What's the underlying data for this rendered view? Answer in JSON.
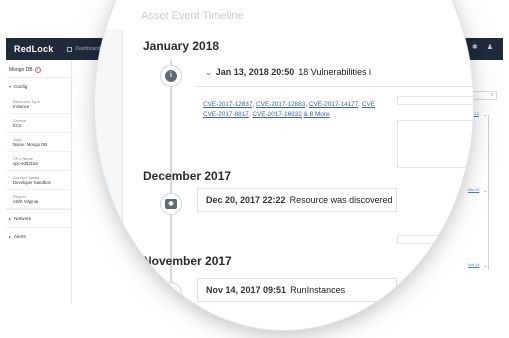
{
  "app": {
    "brand": "RedLock",
    "nav_dashboard": "Dashboard"
  },
  "sidebar": {
    "resource_title": "Mongo DB",
    "config_section": "Config",
    "fields": [
      {
        "label": "Resource Type",
        "value": "Instance"
      },
      {
        "label": "Service",
        "value": "EC2"
      },
      {
        "label": "Tags",
        "value": "Name: Mongo DB"
      },
      {
        "label": "VPC Name",
        "value": "vpc-ed0318a"
      },
      {
        "label": "Account Name",
        "value": "Developer Sandbox"
      },
      {
        "label": "Region",
        "value": "AWS Virginia"
      }
    ],
    "network_section": "Network",
    "alerts_section": "Alerts"
  },
  "timeline": {
    "ghost_title": "Asset Event Timeline",
    "months": [
      {
        "label": "January 2018",
        "event": {
          "datetime": "Jan 13, 2018 20:50",
          "description": "18 Vulnerabilities i",
          "cve_line1": [
            "CVE-2017-12837",
            "CVE-2017-12883",
            "CVE-2017-14177",
            "CVE"
          ],
          "cve_line2": [
            "CVE-2017-8817",
            "CVE-2017-16932",
            "& 8 More"
          ]
        }
      },
      {
        "label": "December 2017",
        "event": {
          "datetime": "Dec 20, 2017 22:22",
          "description": "Resource was discovered"
        }
      },
      {
        "label": "November 2017",
        "event": {
          "datetime": "Nov 14, 2017 09:51",
          "description": "RunInstances"
        }
      }
    ]
  },
  "right_links": {
    "link1": "Jan 13",
    "link2": "Dec 20",
    "link3": "Nov 14",
    "mid_link": "CVE-2017-8"
  },
  "icons": {
    "info": "info-icon",
    "camera": "camera-icon",
    "plus": "plus-icon",
    "search": "search-icon",
    "chevron": "chevron-down-icon"
  },
  "colors": {
    "topbar": "#1f2b3a",
    "link": "#3a66b8",
    "alert": "#d9534f"
  }
}
